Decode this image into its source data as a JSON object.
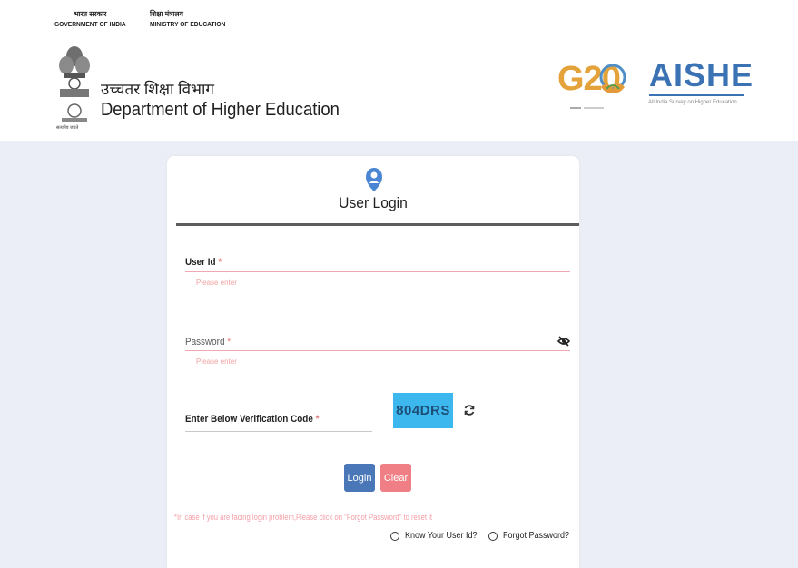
{
  "header": {
    "gov_hindi": "भारत सरकार",
    "gov_english": "GOVERNMENT OF INDIA",
    "ministry_hindi": "शिक्षा मंत्रालय",
    "ministry_english": "MINISTRY OF EDUCATION",
    "dept_hindi": "उच्चतर शिक्षा विभाग",
    "dept_english": "Department of Higher Education",
    "emblem_caption": "सत्यमेव जयते",
    "g20_label": "G20",
    "aishe_title": "AISHE",
    "aishe_subtitle": "All India Survey on Higher Education"
  },
  "login": {
    "title": "User Login",
    "user_id_label": "User Id",
    "user_id_required": "*",
    "user_id_error": "Please enter",
    "password_label": "Password",
    "password_required": "*",
    "password_error": "Please enter",
    "captcha_label": "Enter Below Verification Code",
    "captcha_required": "*",
    "captcha_value": "804DRS",
    "login_button": "Login",
    "clear_button": "Clear",
    "help_text": "*In case if you are facing login problem,Please click on \"Forgot Password\" to reset it",
    "know_user_id": "Know Your User Id?",
    "forgot_password": "Forgot Password?"
  },
  "colors": {
    "accent": "#3a72b3",
    "captcha_bg": "#3db8ee",
    "login_btn": "#4a77b8",
    "clear_btn": "#ef7f85",
    "error_text": "#f2a3a3",
    "page_bg": "#eceef7"
  },
  "icons": {
    "user": "user-icon",
    "eye": "eye-slash-icon",
    "refresh": "refresh-icon"
  }
}
